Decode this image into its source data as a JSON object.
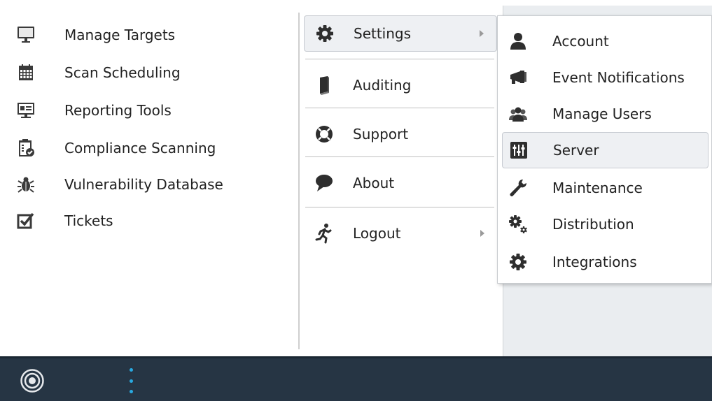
{
  "left_menu": {
    "items": [
      {
        "label": "Manage Targets",
        "icon": "monitor-icon"
      },
      {
        "label": "Scan Scheduling",
        "icon": "calendar-icon"
      },
      {
        "label": "Reporting Tools",
        "icon": "report-board-icon"
      },
      {
        "label": "Compliance Scanning",
        "icon": "compliance-clipboard-icon"
      },
      {
        "label": "Vulnerability Database",
        "icon": "bug-icon"
      },
      {
        "label": "Tickets",
        "icon": "checkbox-ticket-icon"
      }
    ]
  },
  "main_menu": {
    "items": [
      {
        "label": "Settings",
        "icon": "gear-icon",
        "has_submenu": true,
        "active": true
      },
      {
        "label": "Auditing",
        "icon": "book-icon"
      },
      {
        "label": "Support",
        "icon": "lifebuoy-icon"
      },
      {
        "label": "About",
        "icon": "speech-bubble-icon"
      },
      {
        "label": "Logout",
        "icon": "running-man-icon",
        "has_submenu": true
      }
    ]
  },
  "submenu": {
    "items": [
      {
        "label": "Account",
        "icon": "user-icon"
      },
      {
        "label": "Event Notifications",
        "icon": "megaphone-icon"
      },
      {
        "label": "Manage Users",
        "icon": "users-icon"
      },
      {
        "label": "Server",
        "icon": "equalizer-icon",
        "active": true
      },
      {
        "label": "Maintenance",
        "icon": "wrench-icon"
      },
      {
        "label": "Distribution",
        "icon": "gears-icon"
      },
      {
        "label": "Integrations",
        "icon": "gear-icon"
      }
    ]
  },
  "colors": {
    "bottom_bar": "#263544",
    "accent_dots": "#29a9e0",
    "highlight_bg": "#eef0f3",
    "panel_grey": "#eaedf0"
  }
}
